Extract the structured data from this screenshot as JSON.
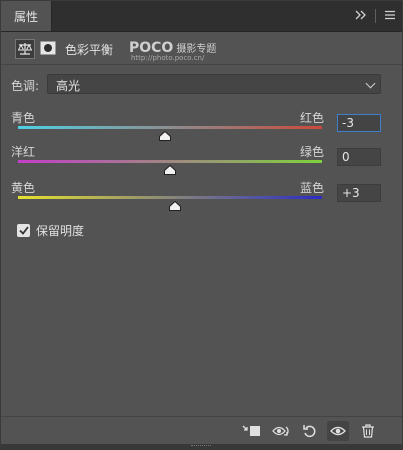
{
  "panel": {
    "tab_title": "属性",
    "expand_icon": "double-chevron-right-icon",
    "menu_icon": "hamburger-icon"
  },
  "header": {
    "title": "色彩平衡",
    "adjustment_icon": "balance-scale-icon",
    "mask_icon": "mask-icon",
    "watermark_main": "POCO",
    "watermark_cn": "摄影专题",
    "watermark_url": "http://photo.poco.cn/"
  },
  "tone": {
    "label": "色调:",
    "value": "高光"
  },
  "sliders": [
    {
      "left_label": "青色",
      "right_label": "红色",
      "value": "-3",
      "level": -3,
      "gradient": [
        "#4fd1e6",
        "#ca4a3a"
      ],
      "active": true
    },
    {
      "left_label": "洋红",
      "right_label": "绿色",
      "value": "0",
      "level": 0,
      "gradient": [
        "#c33ec9",
        "#7ed23c"
      ],
      "active": false
    },
    {
      "left_label": "黄色",
      "right_label": "蓝色",
      "value": "+3",
      "level": 3,
      "gradient": [
        "#e7e22c",
        "#2b2cc6"
      ],
      "active": false
    }
  ],
  "preserve": {
    "label": "保留明度",
    "checked": true
  },
  "toolbar": {
    "clip_icon": "clip-to-layer-icon",
    "view_previous_icon": "view-previous-state-icon",
    "reset_icon": "reset-icon",
    "visibility_icon": "eye-icon",
    "delete_icon": "trash-icon"
  }
}
